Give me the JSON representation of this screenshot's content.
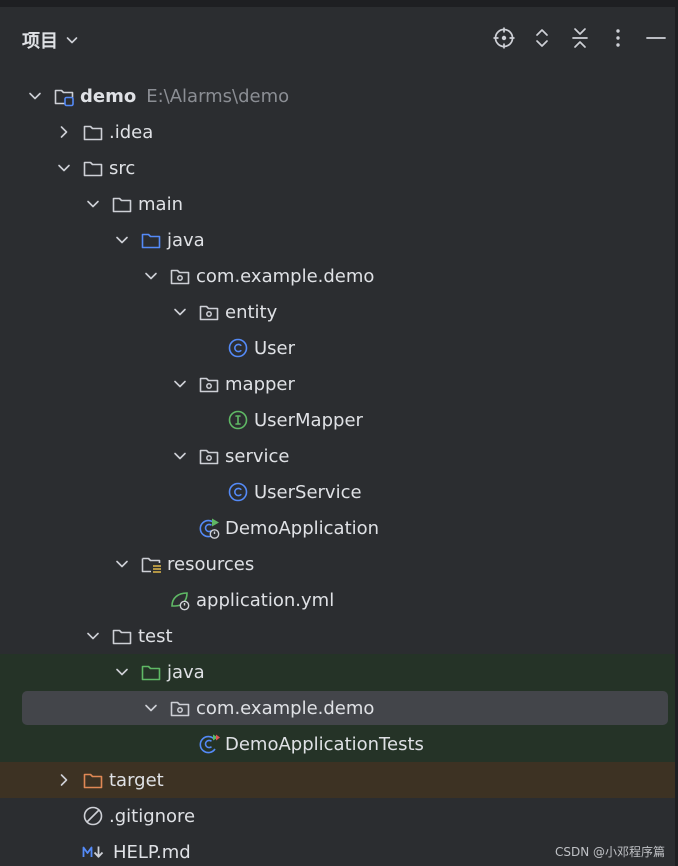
{
  "header": {
    "title": "项目",
    "actions": [
      "locate-icon",
      "expand-all-icon",
      "collapse-all-icon",
      "more-options-icon",
      "hide-icon"
    ]
  },
  "tree": [
    {
      "label": "demo",
      "path": "E:\\Alarms\\demo",
      "depth": 0,
      "arrow": "down",
      "icon": "module-folder-icon",
      "bold": true
    },
    {
      "label": ".idea",
      "depth": 1,
      "arrow": "right",
      "icon": "folder-icon"
    },
    {
      "label": "src",
      "depth": 1,
      "arrow": "down",
      "icon": "folder-icon"
    },
    {
      "label": "main",
      "depth": 2,
      "arrow": "down",
      "icon": "folder-icon"
    },
    {
      "label": "java",
      "depth": 3,
      "arrow": "down",
      "icon": "source-folder-icon"
    },
    {
      "label": "com.example.demo",
      "depth": 4,
      "arrow": "down",
      "icon": "package-icon"
    },
    {
      "label": "entity",
      "depth": 5,
      "arrow": "down",
      "icon": "package-icon"
    },
    {
      "label": "User",
      "depth": 6,
      "arrow": "none",
      "icon": "class-icon"
    },
    {
      "label": "mapper",
      "depth": 5,
      "arrow": "down",
      "icon": "package-icon"
    },
    {
      "label": "UserMapper",
      "depth": 6,
      "arrow": "none",
      "icon": "interface-icon"
    },
    {
      "label": "service",
      "depth": 5,
      "arrow": "down",
      "icon": "package-icon"
    },
    {
      "label": "UserService",
      "depth": 6,
      "arrow": "none",
      "icon": "class-icon"
    },
    {
      "label": "DemoApplication",
      "depth": 5,
      "arrow": "none",
      "icon": "spring-boot-app-icon"
    },
    {
      "label": "resources",
      "depth": 3,
      "arrow": "down",
      "icon": "resources-folder-icon"
    },
    {
      "label": "application.yml",
      "depth": 4,
      "arrow": "none",
      "icon": "spring-config-icon"
    },
    {
      "label": "test",
      "depth": 2,
      "arrow": "down",
      "icon": "folder-icon"
    },
    {
      "label": "java",
      "depth": 3,
      "arrow": "down",
      "icon": "test-folder-icon",
      "bg": "green"
    },
    {
      "label": "com.example.demo",
      "depth": 4,
      "arrow": "down",
      "icon": "package-icon",
      "bg": "green",
      "selected": true
    },
    {
      "label": "DemoApplicationTests",
      "depth": 5,
      "arrow": "none",
      "icon": "test-class-icon",
      "bg": "green"
    },
    {
      "label": "target",
      "depth": 1,
      "arrow": "right",
      "icon": "excluded-folder-icon",
      "bg": "brown"
    },
    {
      "label": ".gitignore",
      "depth": 1,
      "arrow": "none",
      "icon": "ignore-file-icon"
    },
    {
      "label": "HELP.md",
      "depth": 1,
      "arrow": "none",
      "icon": "markdown-icon"
    }
  ],
  "colors": {
    "background": "#2b2d30",
    "text": "#dfe1e5",
    "path": "#8b8e94",
    "folder_outline": "#ced0d6",
    "source_blue": "#548af7",
    "test_green": "#5fb865",
    "excluded_orange": "#e08855",
    "selected": "#43454a",
    "test_bg": "#253327",
    "excluded_bg": "#3d3223"
  },
  "watermark": "CSDN @小邓程序篇"
}
